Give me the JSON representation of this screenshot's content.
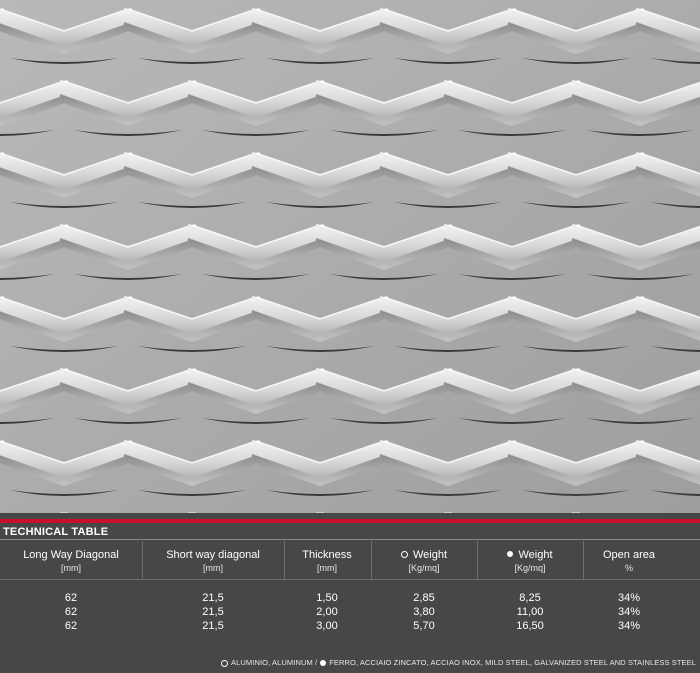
{
  "table": {
    "title": "TECHNICAL TABLE",
    "headers": [
      {
        "label": "Long Way Diagonal",
        "unit": "[mm]"
      },
      {
        "label": "Short way diagonal",
        "unit": "[mm]"
      },
      {
        "label": "Thickness",
        "unit": "[mm]"
      },
      {
        "label": "Weight",
        "unit": "[Kg/mq]",
        "marker": "open-circle"
      },
      {
        "label": "Weight",
        "unit": "[Kg/mq]",
        "marker": "filled-circle"
      },
      {
        "label": "Open area",
        "unit": "%"
      }
    ],
    "rows": [
      [
        "62",
        "21,5",
        "1,50",
        "2,85",
        "8,25",
        "34%"
      ],
      [
        "62",
        "21,5",
        "2,00",
        "3,80",
        "11,00",
        "34%"
      ],
      [
        "62",
        "21,5",
        "3,00",
        "5,70",
        "16,50",
        "34%"
      ]
    ]
  },
  "footer": {
    "aluminum": "ALUMINIO, ALUMINUM /",
    "steel": "FERRO, ACCIAIO ZINCATO, ACCIAO INOX, MILD STEEL, GALVANIZED STEEL AND STAINLESS STEEL"
  },
  "colors": {
    "accent_red": "#c8102e",
    "panel_bg": "#474747"
  }
}
